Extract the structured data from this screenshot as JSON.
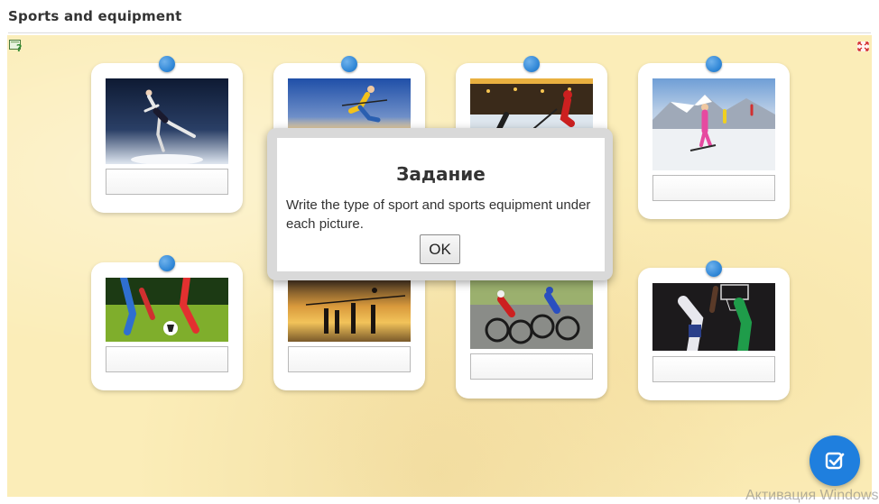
{
  "header": {
    "title": "Sports and equipment"
  },
  "icons": {
    "help": "help-icon",
    "fullscreen": "fullscreen-icon",
    "check": "check-icon"
  },
  "colors": {
    "board": "#fbedb8",
    "pin": "#2f86d6",
    "check_button": "#1f7fde"
  },
  "cards": [
    {
      "picture": "figure skating",
      "answer": ""
    },
    {
      "picture": "skiing",
      "answer": ""
    },
    {
      "picture": "ice hockey",
      "answer": ""
    },
    {
      "picture": "skiing",
      "answer": ""
    },
    {
      "picture": "football",
      "answer": ""
    },
    {
      "picture": "volleyball",
      "answer": ""
    },
    {
      "picture": "cycling",
      "answer": ""
    },
    {
      "picture": "basketball",
      "answer": ""
    }
  ],
  "modal": {
    "title": "Задание",
    "text": "Write the type of sport and sports equipment under each picture.",
    "ok_label": "OK"
  },
  "watermark": "Активация Windows"
}
